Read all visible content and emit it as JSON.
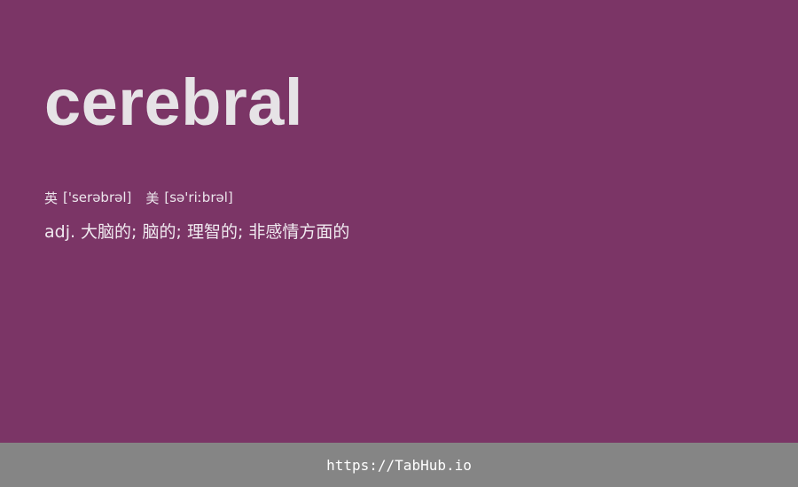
{
  "word": "cerebral",
  "pronunciations": {
    "uk": {
      "label": "英",
      "ipa": "['serəbrəl]"
    },
    "us": {
      "label": "美",
      "ipa": "[sə'riːbrəl]"
    }
  },
  "definition": "adj. 大脑的; 脑的; 理智的; 非感情方面的",
  "footer": {
    "url": "https://TabHub.io"
  },
  "colors": {
    "background": "#7b3566",
    "footer_background": "#858585",
    "text": "#e6e3e6"
  }
}
